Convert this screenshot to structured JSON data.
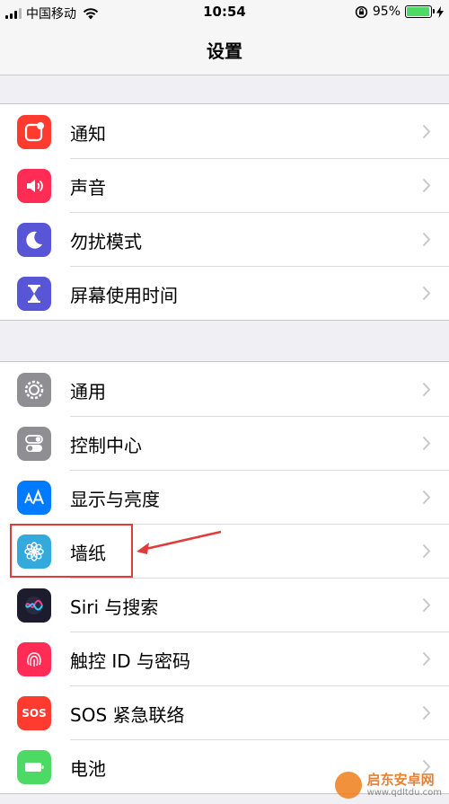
{
  "status_bar": {
    "carrier": "中国移动",
    "time": "10:54",
    "battery_percent": "95%",
    "battery_level": 0.95,
    "signal_bars_active": 3,
    "signal_bars_total": 4
  },
  "nav": {
    "title": "设置"
  },
  "groups": [
    {
      "items": [
        {
          "label": "通知",
          "icon": "notifications-icon",
          "color": "#ff3b30"
        },
        {
          "label": "声音",
          "icon": "sounds-icon",
          "color": "#ff2d55"
        },
        {
          "label": "勿扰模式",
          "icon": "moon-icon",
          "color": "#5856d6"
        },
        {
          "label": "屏幕使用时间",
          "icon": "hourglass-icon",
          "color": "#5856d6"
        }
      ]
    },
    {
      "items": [
        {
          "label": "通用",
          "icon": "gear-icon",
          "color": "#8e8e93"
        },
        {
          "label": "控制中心",
          "icon": "toggles-icon",
          "color": "#8e8e93"
        },
        {
          "label": "显示与亮度",
          "icon": "text-size-icon",
          "color": "#007aff"
        },
        {
          "label": "墙纸",
          "icon": "flower-icon",
          "color": "#34aadc"
        },
        {
          "label": "Siri 与搜索",
          "icon": "siri-icon",
          "color": "#1c1c2e"
        },
        {
          "label": "触控 ID 与密码",
          "icon": "fingerprint-icon",
          "color": "#ff2d55"
        },
        {
          "label": "SOS 紧急联络",
          "icon": "sos-icon",
          "color": "#ff3b30",
          "icon_text": "SOS"
        },
        {
          "label": "电池",
          "icon": "battery-icon",
          "color": "#4cd964"
        }
      ]
    }
  ],
  "watermark": {
    "name": "启东安卓网",
    "url": "www.qdltdu.com"
  }
}
